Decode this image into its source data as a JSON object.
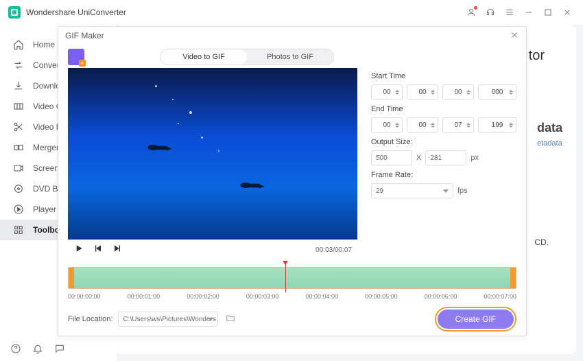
{
  "app": {
    "name": "Wondershare UniConverter"
  },
  "sidebar": {
    "items": [
      {
        "label": "Home"
      },
      {
        "label": "Converter"
      },
      {
        "label": "Downloader"
      },
      {
        "label": "Video Compressor"
      },
      {
        "label": "Video Editor"
      },
      {
        "label": "Merger"
      },
      {
        "label": "Screen Recorder"
      },
      {
        "label": "DVD Burner"
      },
      {
        "label": "Player"
      },
      {
        "label": "Toolbox"
      }
    ]
  },
  "bgcard": {
    "title_suffix": "tor",
    "meta_title": "data",
    "meta_sub": "etadata",
    "line": "CD."
  },
  "modal": {
    "title": "GIF Maker",
    "tabs": {
      "video": "Video to GIF",
      "photos": "Photos to GIF"
    },
    "time": {
      "start_label": "Start Time",
      "start": [
        "00",
        "00",
        "00",
        "000"
      ],
      "end_label": "End Time",
      "end": [
        "00",
        "00",
        "07",
        "199"
      ],
      "output_label": "Output Size:",
      "width": "500",
      "sep": "X",
      "height": "281",
      "unit": "px",
      "frame_label": "Frame Rate:",
      "frame": "29",
      "fps": "fps"
    },
    "controls": {
      "pos": "00:03/00:07"
    },
    "ticks": [
      "00:00:00:00",
      "00:00:01:00",
      "00:00:02:00",
      "00:00:03:00",
      "00:00:04:00",
      "00:00:05:00",
      "00:00:06:00",
      "00:00:07:00"
    ],
    "footer": {
      "label": "File Location:",
      "path": "C:\\Users\\ws\\Pictures\\Wonders",
      "create": "Create GIF"
    }
  }
}
